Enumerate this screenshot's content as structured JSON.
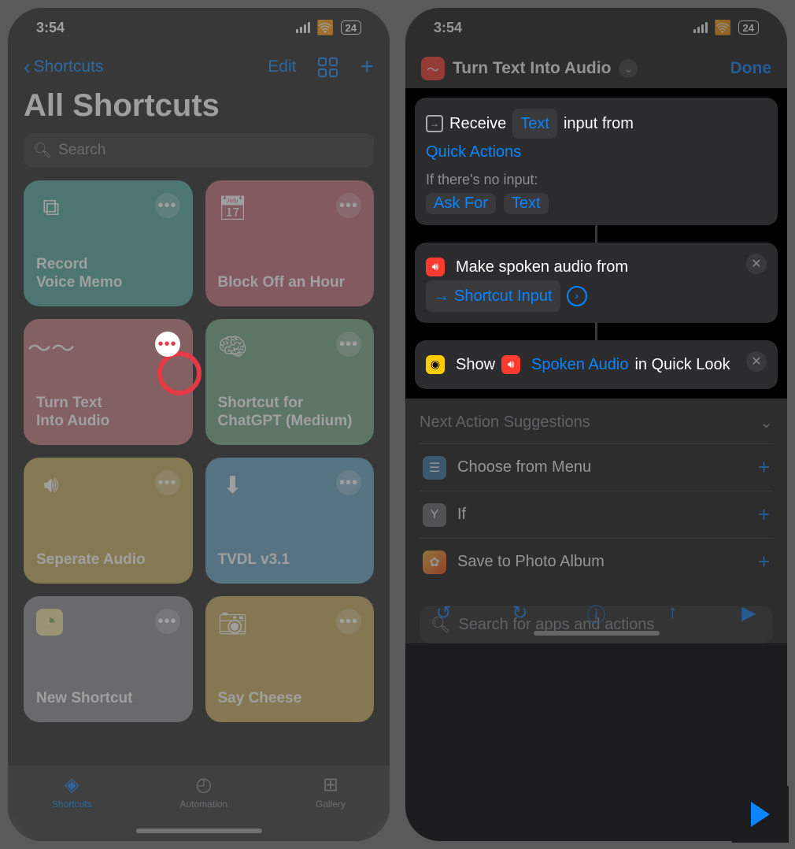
{
  "status": {
    "time": "3:54",
    "battery": "24"
  },
  "left": {
    "back_label": "Shortcuts",
    "edit_label": "Edit",
    "title": "All Shortcuts",
    "search_placeholder": "Search",
    "tiles": [
      {
        "label": "Record\nVoice Memo",
        "color": "#4aa29a"
      },
      {
        "label": "Block Off an Hour",
        "color": "#bf6773"
      },
      {
        "label": "Turn Text\nInto Audio",
        "color": "#c27378"
      },
      {
        "label": "Shortcut for ChatGPT (Medium)",
        "color": "#6ea37e"
      },
      {
        "label": "Seperate Audio",
        "color": "#c6aa57"
      },
      {
        "label": "TVDL v3.1",
        "color": "#5e9cc0"
      },
      {
        "label": "New Shortcut",
        "color": "#8a8a8e"
      },
      {
        "label": "Say Cheese",
        "color": "#c3a754"
      }
    ],
    "tabs": {
      "shortcuts": "Shortcuts",
      "automation": "Automation",
      "gallery": "Gallery"
    }
  },
  "right": {
    "title": "Turn Text Into Audio",
    "done": "Done",
    "receive": {
      "prefix": "Receive",
      "type": "Text",
      "suffix": "input from",
      "source": "Quick Actions",
      "noinput_label": "If there's no input:",
      "askfor": "Ask For",
      "askfor_type": "Text"
    },
    "make": {
      "text": "Make spoken audio from",
      "input_label": "Shortcut Input"
    },
    "show": {
      "prefix": "Show",
      "token": "Spoken Audio",
      "suffix": "in Quick Look"
    },
    "suggestions_header": "Next Action Suggestions",
    "suggestions": [
      {
        "label": "Choose from Menu",
        "color": "#4a90c2",
        "glyph": "☰"
      },
      {
        "label": "If",
        "color": "#8e8e93",
        "glyph": "Y"
      },
      {
        "label": "Save to Photo Album",
        "color": "#ffffff",
        "glyph": "✿"
      }
    ],
    "search_placeholder": "Search for apps and actions"
  }
}
